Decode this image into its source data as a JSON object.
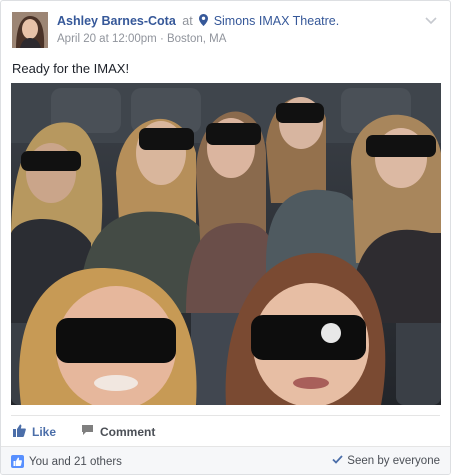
{
  "post": {
    "author": "Ashley Barnes-Cota",
    "at_word": "at",
    "place": "Simons IMAX Theatre.",
    "date": "April 20 at 12:00pm",
    "separator": "·",
    "location": "Boston, MA",
    "text": "Ready for the IMAX!"
  },
  "actions": {
    "like_label": "Like",
    "comment_label": "Comment"
  },
  "footer": {
    "reactions_text": "You and 21 others",
    "seen_text": "Seen by everyone"
  },
  "colors": {
    "link": "#365899",
    "meta": "#90949c",
    "like_blue": "#4b6ea9",
    "footer_bg": "#f6f7f9"
  },
  "icons": [
    "location-pin-icon",
    "chevron-down-icon",
    "like-thumb-icon",
    "comment-bubble-icon",
    "like-reaction-icon",
    "checkmark-icon"
  ]
}
